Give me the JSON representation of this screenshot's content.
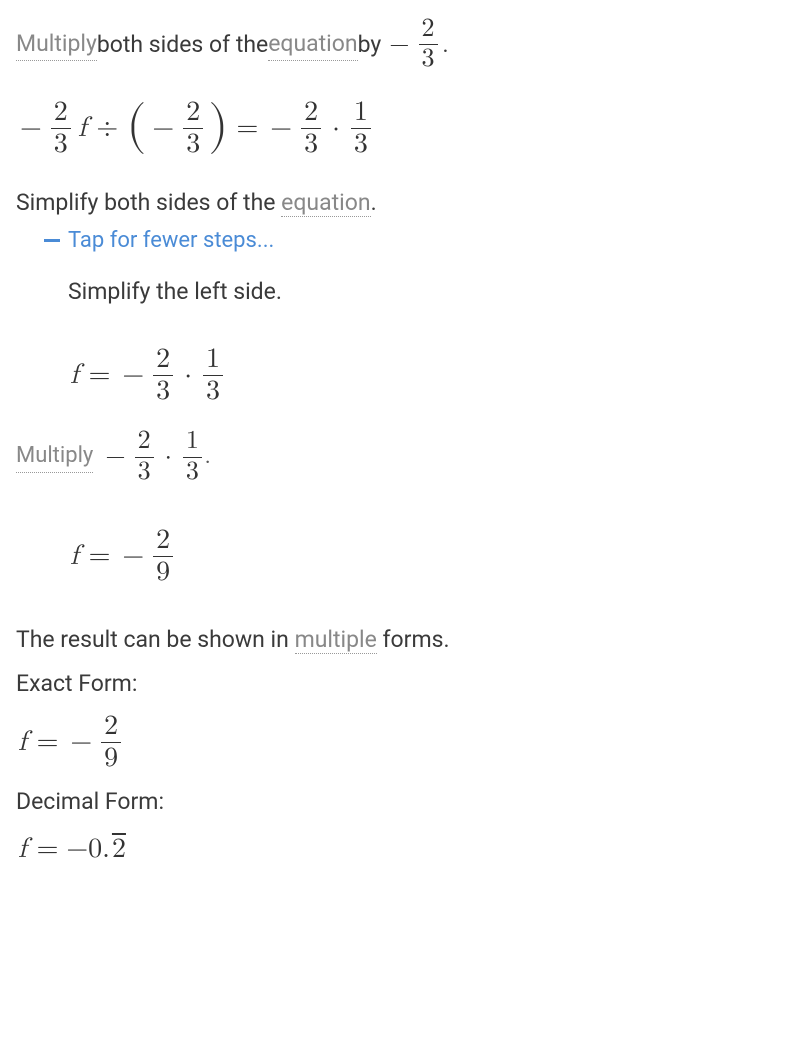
{
  "step1": {
    "pre": "Multiply",
    "mid": " both sides of the ",
    "link2": "equation",
    "post": " by "
  },
  "math1": {
    "f1n": "2",
    "f1d": "3",
    "div": "÷",
    "f2n": "2",
    "f2d": "3",
    "eq": "=",
    "f3n": "2",
    "f3d": "3",
    "f4n": "1",
    "f4d": "3",
    "dot": "·",
    "minus": "−",
    "var": "f"
  },
  "step2": {
    "text1": "Simplify both sides of the ",
    "link": "equation",
    "period": "."
  },
  "tap": "Tap for fewer steps...",
  "sub1": "Simplify the left side.",
  "math2": {
    "var": "f",
    "eq": "=",
    "minus": "−",
    "f1n": "2",
    "f1d": "3",
    "dot": "·",
    "f2n": "1",
    "f2d": "3"
  },
  "sub2": {
    "pre": "Multiply",
    "minus": "−",
    "f1n": "2",
    "f1d": "3",
    "dot": "·",
    "f2n": "1",
    "f2d": "3"
  },
  "math3": {
    "var": "f",
    "eq": "=",
    "minus": "−",
    "fn": "2",
    "fd": "9"
  },
  "result_line": {
    "pre": "The result can be shown in ",
    "link": "multiple",
    "post": " forms."
  },
  "exact_label": "Exact Form:",
  "math4": {
    "var": "f",
    "eq": "=",
    "minus": "−",
    "fn": "2",
    "fd": "9"
  },
  "decimal_label": "Decimal Form:",
  "math5": {
    "var": "f",
    "eq": "=",
    "val_pre": "−0.",
    "val_rep": "2"
  },
  "topfrac": {
    "minus": "−",
    "n": "2",
    "d": "3",
    "period": "."
  }
}
